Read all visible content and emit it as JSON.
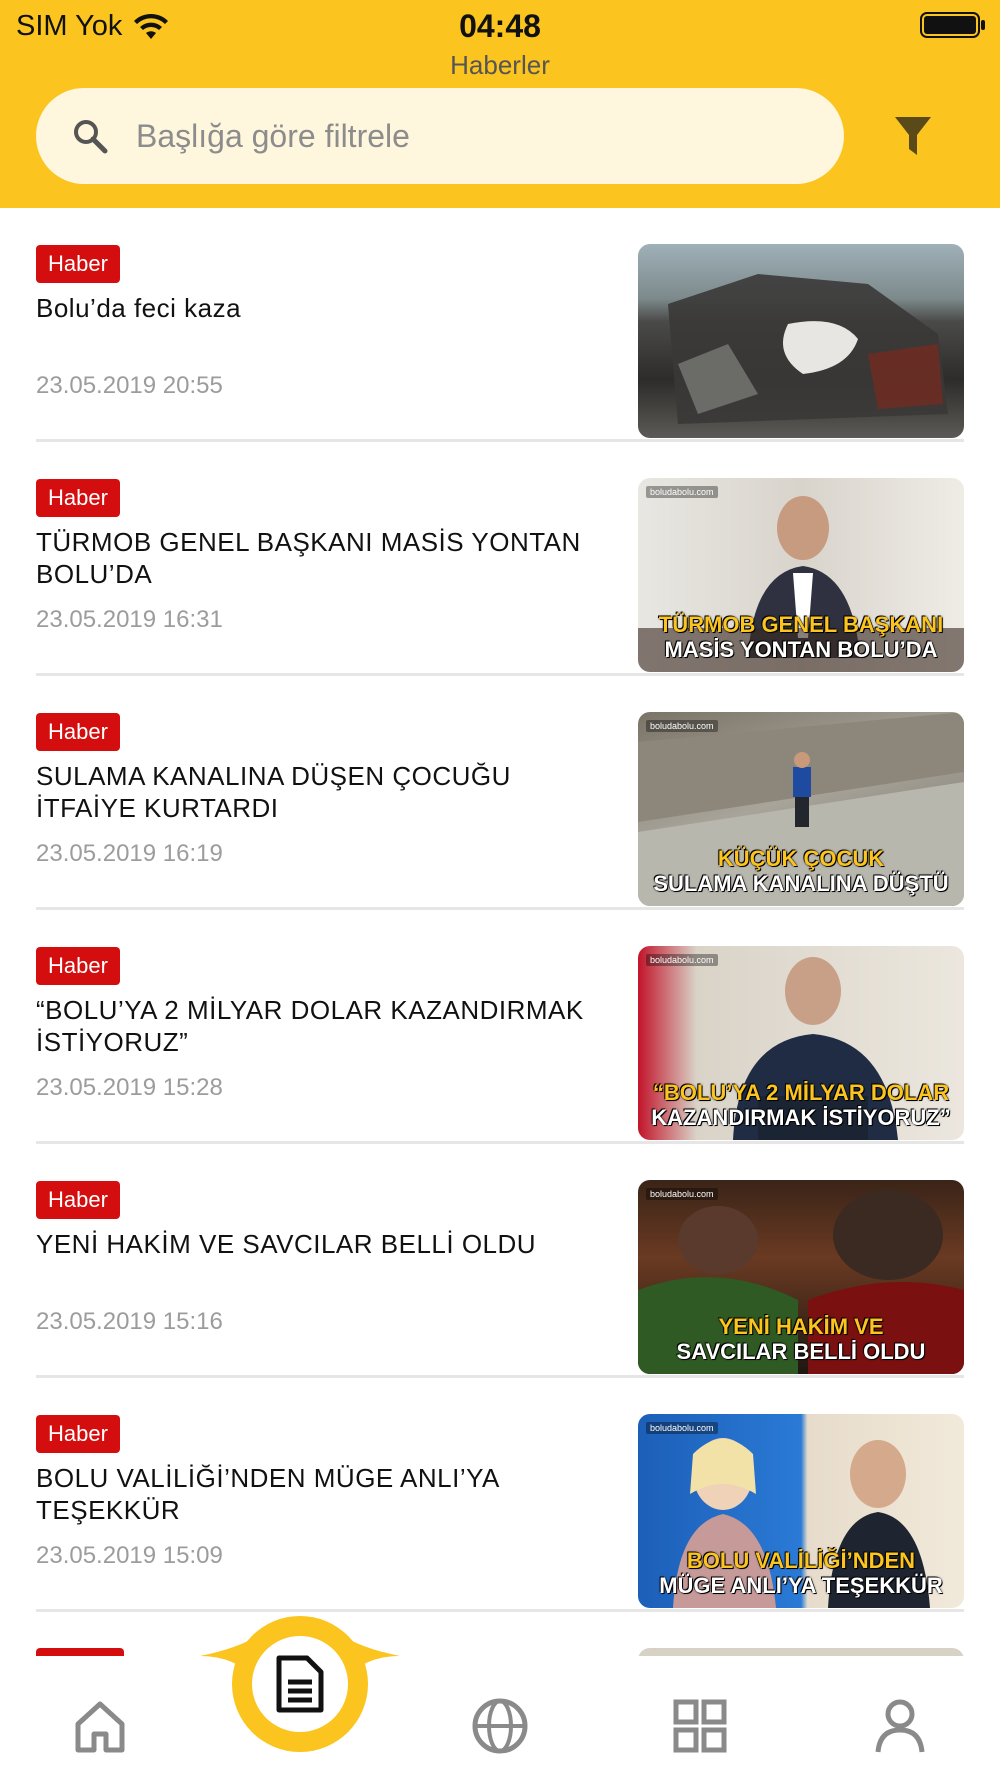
{
  "status_bar": {
    "carrier": "SIM Yok",
    "time": "04:48"
  },
  "header": {
    "title": "Haberler",
    "search_placeholder": "Başlığa göre filtrele"
  },
  "colors": {
    "brand_yellow": "#fbc41e",
    "badge_red": "#d40e0e"
  },
  "icons": {
    "search": "search-icon",
    "filter": "filter-icon",
    "home": "home-icon",
    "news": "document-icon",
    "world": "globe-icon",
    "categories": "grid-icon",
    "profile": "user-icon"
  },
  "news": [
    {
      "badge": "Haber",
      "title": "Bolu’da feci kaza",
      "date": "23.05.2019 20:55",
      "caption_top": "",
      "caption_bottom": ""
    },
    {
      "badge": "Haber",
      "title": "TÜRMOB GENEL BAŞKANI MASİS YONTAN BOLU’DA",
      "date": "23.05.2019 16:31",
      "caption_top": "TÜRMOB GENEL BAŞKANI",
      "caption_bottom": "MASİS YONTAN BOLU’DA"
    },
    {
      "badge": "Haber",
      "title": "SULAMA KANALINA DÜŞEN ÇOCUĞU İTFAİYE KURTARDI",
      "date": "23.05.2019 16:19",
      "caption_top": "KÜÇÜK ÇOCUK",
      "caption_bottom": "SULAMA KANALINA DÜŞTÜ"
    },
    {
      "badge": "Haber",
      "title": "“BOLU’YA 2 MİLYAR DOLAR KAZANDIRMAK İSTİYORUZ”",
      "date": "23.05.2019 15:28",
      "caption_top": "“BOLU’YA 2 MİLYAR DOLAR",
      "caption_bottom": "KAZANDIRMAK İSTİYORUZ”"
    },
    {
      "badge": "Haber",
      "title": "YENİ HAKİM VE SAVCILAR BELLİ OLDU",
      "date": "23.05.2019 15:16",
      "caption_top": "YENİ HAKİM VE",
      "caption_bottom": "SAVCILAR BELLİ OLDU"
    },
    {
      "badge": "Haber",
      "title": "BOLU VALİLİĞİ’NDEN MÜGE ANLI’YA TEŞEKKÜR",
      "date": "23.05.2019 15:09",
      "caption_top": "BOLU VALİLİĞİ’NDEN",
      "caption_bottom": "MÜGE ANLI’YA TEŞEKKÜR"
    }
  ]
}
